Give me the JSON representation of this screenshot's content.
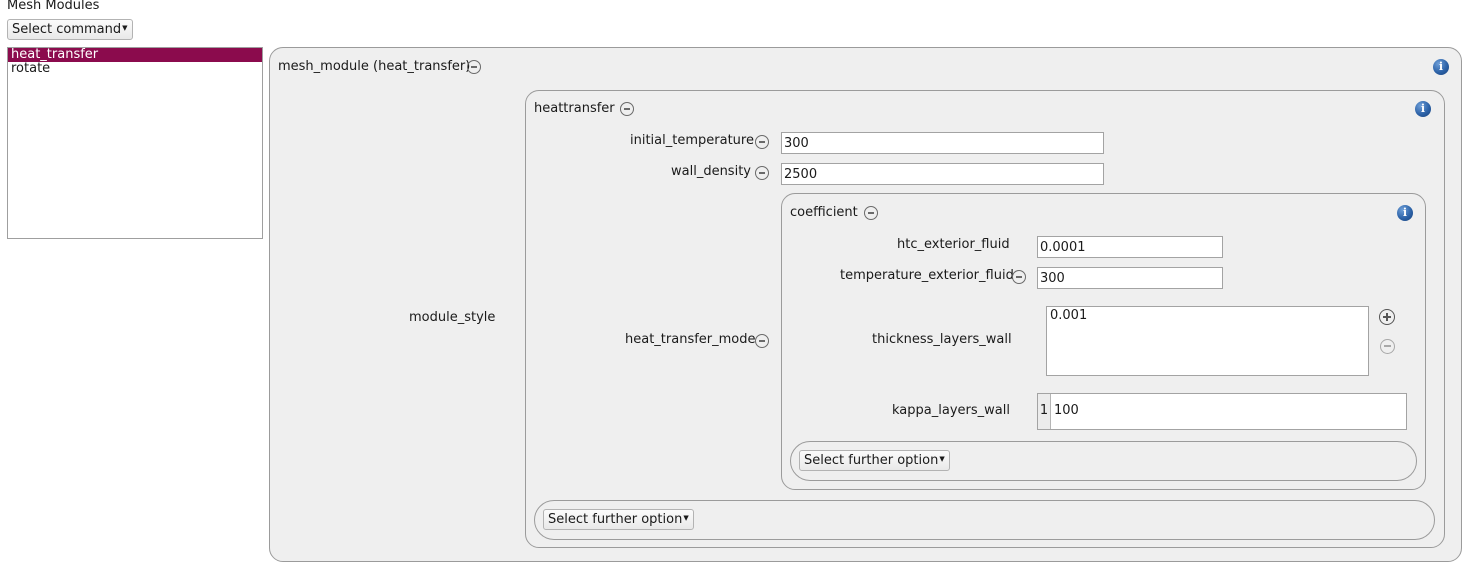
{
  "header": {
    "title": "Mesh Modules",
    "select_command": "Select command"
  },
  "module_list": {
    "items": [
      "heat_transfer",
      "rotate"
    ],
    "selected_index": 0
  },
  "mesh_module": {
    "label": "mesh_module (heat_transfer)",
    "module_style_label": "module_style",
    "heattransfer": {
      "label": "heattransfer",
      "initial_temperature": {
        "label": "initial_temperature",
        "value": "300"
      },
      "wall_density": {
        "label": "wall_density",
        "value": "2500"
      },
      "heat_transfer_mode_label": "heat_transfer_mode",
      "coefficient": {
        "label": "coefficient",
        "htc_exterior_fluid": {
          "label": "htc_exterior_fluid",
          "value": "0.0001"
        },
        "temperature_exterior_fluid": {
          "label": "temperature_exterior_fluid",
          "value": "300"
        },
        "thickness_layers_wall": {
          "label": "thickness_layers_wall",
          "value": "0.001"
        },
        "kappa_layers_wall": {
          "label": "kappa_layers_wall",
          "row_index": "1",
          "value": "100"
        },
        "select_further_option": "Select further option"
      },
      "select_further_option": "Select further option"
    }
  },
  "colors": {
    "selection": "#8b0b4d",
    "info_icon": "#2d63a8",
    "panel_background": "#efefef"
  },
  "icons": {
    "collapse": "minus-circle-icon",
    "add": "plus-circle-icon",
    "info": "info-icon"
  }
}
